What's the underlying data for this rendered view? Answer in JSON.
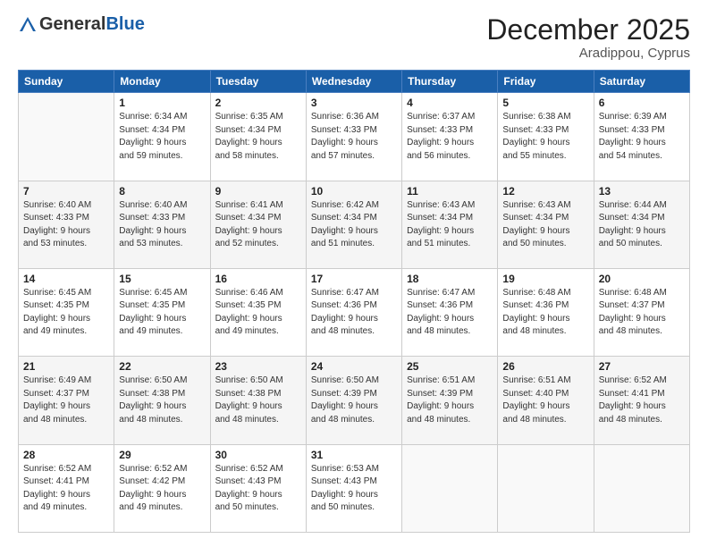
{
  "header": {
    "logo_general": "General",
    "logo_blue": "Blue",
    "month_title": "December 2025",
    "location": "Aradippou, Cyprus"
  },
  "weekdays": [
    "Sunday",
    "Monday",
    "Tuesday",
    "Wednesday",
    "Thursday",
    "Friday",
    "Saturday"
  ],
  "weeks": [
    [
      {
        "day": "",
        "info": ""
      },
      {
        "day": "1",
        "info": "Sunrise: 6:34 AM\nSunset: 4:34 PM\nDaylight: 9 hours\nand 59 minutes."
      },
      {
        "day": "2",
        "info": "Sunrise: 6:35 AM\nSunset: 4:34 PM\nDaylight: 9 hours\nand 58 minutes."
      },
      {
        "day": "3",
        "info": "Sunrise: 6:36 AM\nSunset: 4:33 PM\nDaylight: 9 hours\nand 57 minutes."
      },
      {
        "day": "4",
        "info": "Sunrise: 6:37 AM\nSunset: 4:33 PM\nDaylight: 9 hours\nand 56 minutes."
      },
      {
        "day": "5",
        "info": "Sunrise: 6:38 AM\nSunset: 4:33 PM\nDaylight: 9 hours\nand 55 minutes."
      },
      {
        "day": "6",
        "info": "Sunrise: 6:39 AM\nSunset: 4:33 PM\nDaylight: 9 hours\nand 54 minutes."
      }
    ],
    [
      {
        "day": "7",
        "info": "Sunrise: 6:40 AM\nSunset: 4:33 PM\nDaylight: 9 hours\nand 53 minutes."
      },
      {
        "day": "8",
        "info": "Sunrise: 6:40 AM\nSunset: 4:33 PM\nDaylight: 9 hours\nand 53 minutes."
      },
      {
        "day": "9",
        "info": "Sunrise: 6:41 AM\nSunset: 4:34 PM\nDaylight: 9 hours\nand 52 minutes."
      },
      {
        "day": "10",
        "info": "Sunrise: 6:42 AM\nSunset: 4:34 PM\nDaylight: 9 hours\nand 51 minutes."
      },
      {
        "day": "11",
        "info": "Sunrise: 6:43 AM\nSunset: 4:34 PM\nDaylight: 9 hours\nand 51 minutes."
      },
      {
        "day": "12",
        "info": "Sunrise: 6:43 AM\nSunset: 4:34 PM\nDaylight: 9 hours\nand 50 minutes."
      },
      {
        "day": "13",
        "info": "Sunrise: 6:44 AM\nSunset: 4:34 PM\nDaylight: 9 hours\nand 50 minutes."
      }
    ],
    [
      {
        "day": "14",
        "info": "Sunrise: 6:45 AM\nSunset: 4:35 PM\nDaylight: 9 hours\nand 49 minutes."
      },
      {
        "day": "15",
        "info": "Sunrise: 6:45 AM\nSunset: 4:35 PM\nDaylight: 9 hours\nand 49 minutes."
      },
      {
        "day": "16",
        "info": "Sunrise: 6:46 AM\nSunset: 4:35 PM\nDaylight: 9 hours\nand 49 minutes."
      },
      {
        "day": "17",
        "info": "Sunrise: 6:47 AM\nSunset: 4:36 PM\nDaylight: 9 hours\nand 48 minutes."
      },
      {
        "day": "18",
        "info": "Sunrise: 6:47 AM\nSunset: 4:36 PM\nDaylight: 9 hours\nand 48 minutes."
      },
      {
        "day": "19",
        "info": "Sunrise: 6:48 AM\nSunset: 4:36 PM\nDaylight: 9 hours\nand 48 minutes."
      },
      {
        "day": "20",
        "info": "Sunrise: 6:48 AM\nSunset: 4:37 PM\nDaylight: 9 hours\nand 48 minutes."
      }
    ],
    [
      {
        "day": "21",
        "info": "Sunrise: 6:49 AM\nSunset: 4:37 PM\nDaylight: 9 hours\nand 48 minutes."
      },
      {
        "day": "22",
        "info": "Sunrise: 6:50 AM\nSunset: 4:38 PM\nDaylight: 9 hours\nand 48 minutes."
      },
      {
        "day": "23",
        "info": "Sunrise: 6:50 AM\nSunset: 4:38 PM\nDaylight: 9 hours\nand 48 minutes."
      },
      {
        "day": "24",
        "info": "Sunrise: 6:50 AM\nSunset: 4:39 PM\nDaylight: 9 hours\nand 48 minutes."
      },
      {
        "day": "25",
        "info": "Sunrise: 6:51 AM\nSunset: 4:39 PM\nDaylight: 9 hours\nand 48 minutes."
      },
      {
        "day": "26",
        "info": "Sunrise: 6:51 AM\nSunset: 4:40 PM\nDaylight: 9 hours\nand 48 minutes."
      },
      {
        "day": "27",
        "info": "Sunrise: 6:52 AM\nSunset: 4:41 PM\nDaylight: 9 hours\nand 48 minutes."
      }
    ],
    [
      {
        "day": "28",
        "info": "Sunrise: 6:52 AM\nSunset: 4:41 PM\nDaylight: 9 hours\nand 49 minutes."
      },
      {
        "day": "29",
        "info": "Sunrise: 6:52 AM\nSunset: 4:42 PM\nDaylight: 9 hours\nand 49 minutes."
      },
      {
        "day": "30",
        "info": "Sunrise: 6:52 AM\nSunset: 4:43 PM\nDaylight: 9 hours\nand 50 minutes."
      },
      {
        "day": "31",
        "info": "Sunrise: 6:53 AM\nSunset: 4:43 PM\nDaylight: 9 hours\nand 50 minutes."
      },
      {
        "day": "",
        "info": ""
      },
      {
        "day": "",
        "info": ""
      },
      {
        "day": "",
        "info": ""
      }
    ]
  ]
}
